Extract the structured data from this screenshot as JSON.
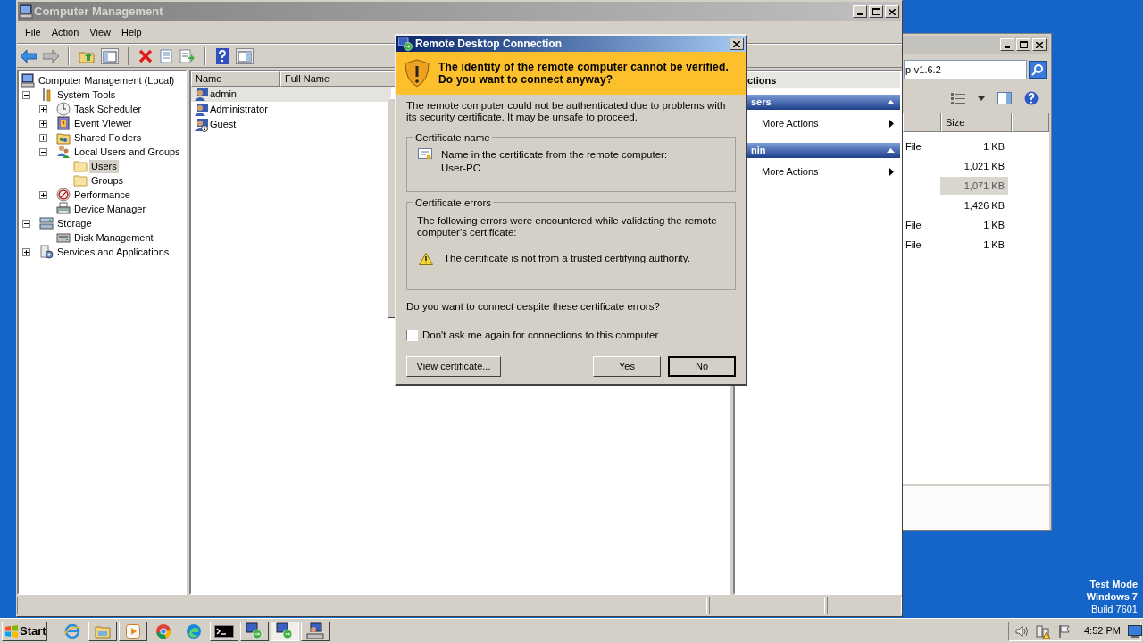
{
  "computer_management": {
    "title": "Computer Management",
    "menu": [
      "File",
      "Action",
      "View",
      "Help"
    ],
    "tree": [
      {
        "label": "Computer Management (Local)",
        "kind": "computer",
        "selected": false,
        "children": [
          {
            "label": "System Tools",
            "kind": "tools",
            "selected": false,
            "expanded": true,
            "children": [
              {
                "label": "Task Scheduler",
                "kind": "clock",
                "selected": false,
                "expanded": false
              },
              {
                "label": "Event Viewer",
                "kind": "event",
                "selected": false,
                "expanded": false
              },
              {
                "label": "Shared Folders",
                "kind": "share",
                "selected": false,
                "expanded": false
              },
              {
                "label": "Local Users and Groups",
                "kind": "users",
                "selected": false,
                "expanded": true,
                "children": [
                  {
                    "label": "Users",
                    "kind": "folder",
                    "selected": true
                  },
                  {
                    "label": "Groups",
                    "kind": "folder",
                    "selected": false
                  }
                ]
              },
              {
                "label": "Performance",
                "kind": "performance",
                "selected": false,
                "expanded": false
              },
              {
                "label": "Device Manager",
                "kind": "device",
                "selected": false
              }
            ]
          },
          {
            "label": "Storage",
            "kind": "storage",
            "selected": false,
            "expanded": true,
            "children": [
              {
                "label": "Disk Management",
                "kind": "disk",
                "selected": false
              }
            ]
          },
          {
            "label": "Services and Applications",
            "kind": "services",
            "selected": false,
            "expanded": false
          }
        ]
      }
    ],
    "list": {
      "columns": [
        "Name",
        "Full Name"
      ],
      "rows": [
        {
          "name": "admin",
          "kind": "user",
          "selected": true
        },
        {
          "name": "Administrator",
          "kind": "user",
          "selected": false
        },
        {
          "name": "Guest",
          "kind": "disabled_user",
          "selected": false
        }
      ]
    },
    "actions": {
      "title": "ctions",
      "sections": [
        {
          "title": "sers",
          "items": [
            "More Actions"
          ]
        },
        {
          "title": "nin",
          "items": [
            "More Actions"
          ]
        }
      ]
    }
  },
  "explorer": {
    "address": "p-v1.6.2",
    "columns": [
      "Size"
    ],
    "rows": [
      {
        "type": "File",
        "size": "1 KB",
        "selected": false
      },
      {
        "size": "1,021 KB",
        "selected": false
      },
      {
        "size": "1,071 KB",
        "selected": true
      },
      {
        "size": "1,426 KB",
        "selected": false
      },
      {
        "type": "File",
        "size": "1 KB",
        "selected": false
      },
      {
        "type": "File",
        "size": "1 KB",
        "selected": false
      }
    ]
  },
  "dialog": {
    "title": "Remote Desktop Connection",
    "heading": "The identity of the remote computer cannot be verified. Do you want to connect anyway?",
    "message": "The remote computer could not be authenticated due to problems with its security certificate. It may be unsafe to proceed.",
    "certificate_name": {
      "legend": "Certificate name",
      "label": "Name in the certificate from the remote computer:",
      "value": "User-PC"
    },
    "certificate_errors": {
      "legend": "Certificate errors",
      "intro": "The following errors were encountered while validating the remote computer's certificate:",
      "errors": [
        "The certificate is not from a trusted certifying authority."
      ]
    },
    "question": "Do you want to connect despite these certificate errors?",
    "checkbox": {
      "label": "Don't ask me again for connections to this computer",
      "checked": false
    },
    "buttons": [
      {
        "label": "View certificate...",
        "default": false
      },
      {
        "label": "Yes",
        "default": false
      },
      {
        "label": "No",
        "default": true
      }
    ]
  },
  "desktop": {
    "lines": [
      "Test Mode",
      "Windows 7",
      "Build 7601"
    ]
  },
  "taskbar": {
    "start": "Start",
    "buttons": [
      {
        "kind": "ie",
        "running": false,
        "selected": false
      },
      {
        "kind": "explorer",
        "running": true,
        "selected": false
      },
      {
        "kind": "media",
        "running": true,
        "selected": false
      },
      {
        "kind": "chrome",
        "running": false,
        "selected": false
      },
      {
        "kind": "edge",
        "running": false,
        "selected": false
      },
      {
        "kind": "cmd",
        "running": true,
        "selected": false
      },
      {
        "kind": "rdp",
        "running": true,
        "selected": false
      },
      {
        "kind": "rdp",
        "running": true,
        "selected": true
      },
      {
        "kind": "network",
        "running": true,
        "selected": false
      }
    ],
    "clock": "4:52 PM"
  }
}
